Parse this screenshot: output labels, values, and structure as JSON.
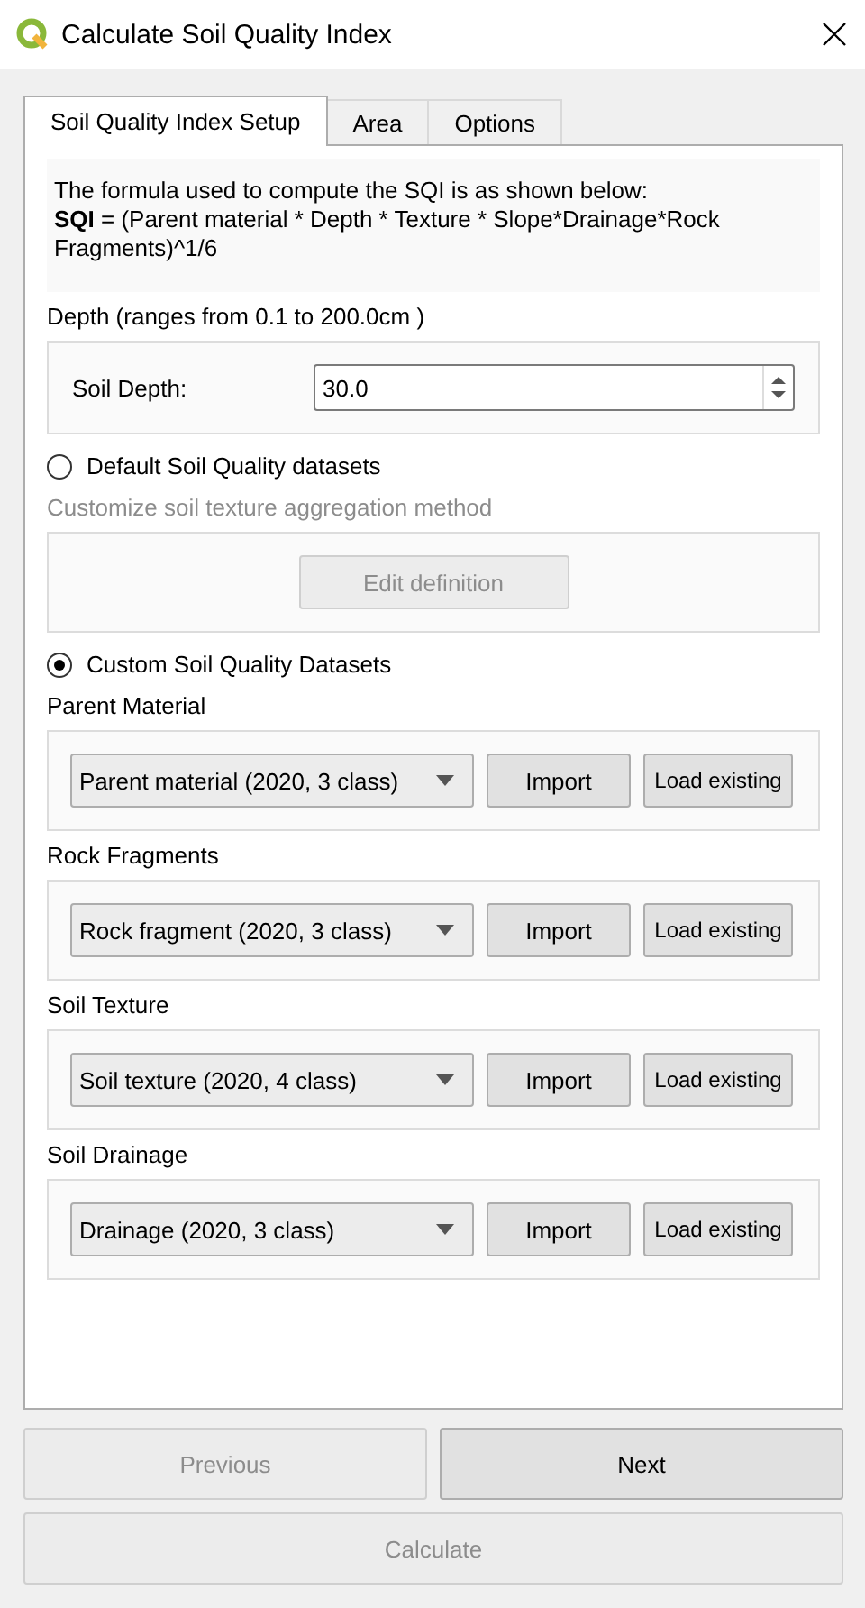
{
  "window": {
    "title": "Calculate Soil Quality Index"
  },
  "tabs": [
    {
      "label": "Soil Quality Index Setup",
      "selected": true
    },
    {
      "label": "Area",
      "selected": false
    },
    {
      "label": "Options",
      "selected": false
    }
  ],
  "formula": {
    "intro": "The formula used to compute the SQI is as shown below:",
    "expression": "**SQI**  = (Parent material * Depth * Texture * Slope*Drainage*Rock Fragments)^1/6"
  },
  "depth": {
    "heading": "Depth (ranges from 0.1 to 200.0cm )",
    "field_label": "Soil Depth:",
    "value": "30.0"
  },
  "default_option": {
    "label": "Default Soil Quality datasets",
    "selected": false
  },
  "aggregation": {
    "heading": "Customize soil texture aggregation method",
    "disabled": true,
    "button": {
      "label": "Edit definition",
      "disabled": true
    }
  },
  "custom_option": {
    "label": "Custom Soil Quality Datasets",
    "selected": true
  },
  "datasets": [
    {
      "heading": "Parent Material",
      "value": "Parent material (2020, 3 class)",
      "import_button": "Import",
      "load_button": "Load existing"
    },
    {
      "heading": "Rock Fragments",
      "value": "Rock fragment (2020, 3 class)",
      "import_button": "Import",
      "load_button": "Load existing"
    },
    {
      "heading": "Soil Texture",
      "value": "Soil texture (2020, 4 class)",
      "import_button": "Import",
      "load_button": "Load existing"
    },
    {
      "heading": "Soil Drainage",
      "value": "Drainage (2020, 3 class)",
      "import_button": "Import",
      "load_button": "Load existing"
    }
  ],
  "nav_buttons": [
    {
      "label": "Previous",
      "disabled": true
    },
    {
      "label": "Next",
      "disabled": false
    }
  ],
  "calculate_button": {
    "label": "Calculate",
    "disabled": true
  }
}
